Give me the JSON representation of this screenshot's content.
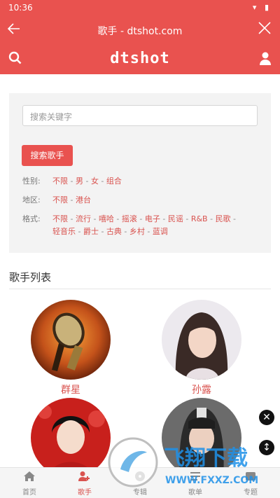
{
  "statusbar": {
    "time": "10:36",
    "icons": "▾ ▮"
  },
  "titlebar": {
    "title": "歌手 - dtshot.com",
    "back_icon": "arrow-left-icon",
    "close_icon": "close-icon"
  },
  "appbar": {
    "logo": "dtshot",
    "search_icon": "search-icon",
    "user_icon": "user-icon"
  },
  "filter": {
    "search_placeholder": "搜索关键字",
    "search_button": "搜索歌手",
    "gender": {
      "label": "性别:",
      "options": [
        "不限",
        "男",
        "女",
        "组合"
      ]
    },
    "region": {
      "label": "地区:",
      "options": [
        "不限",
        "港台"
      ]
    },
    "style": {
      "label": "格式:",
      "options": [
        "不限",
        "流行",
        "嘻哈",
        "摇滚",
        "电子",
        "民谣",
        "R&B",
        "民歌",
        "轻音乐",
        "爵士",
        "古典",
        "乡村",
        "蓝调"
      ]
    }
  },
  "section_title": "歌手列表",
  "artists": [
    {
      "name": "群星"
    },
    {
      "name": "孙露"
    },
    {
      "name": ""
    },
    {
      "name": ""
    }
  ],
  "bottom_nav": [
    {
      "label": "首页",
      "icon": "home-icon"
    },
    {
      "label": "歌手",
      "icon": "singer-icon",
      "active": true
    },
    {
      "label": "专辑",
      "icon": "album-icon"
    },
    {
      "label": "歌单",
      "icon": "playlist-icon"
    },
    {
      "label": "专题",
      "icon": "topic-icon"
    }
  ],
  "watermark": {
    "text": "飞翔下载",
    "url": "WWW.FXXZ.COM"
  },
  "colors": {
    "brand": "#e9524f",
    "link": "#d9534f"
  }
}
